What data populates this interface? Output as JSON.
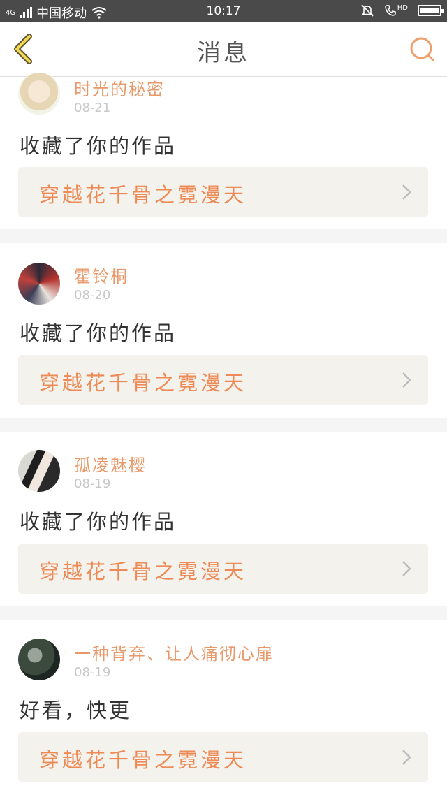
{
  "status_bar": {
    "network": "4G",
    "carrier": "中国移动",
    "time": "10:17",
    "hd_label": "HD"
  },
  "nav": {
    "title": "消息",
    "accent_color": "#f0a06c"
  },
  "messages": [
    {
      "user": "时光的秘密",
      "date": "08-21",
      "action": "收藏了你的作品",
      "work": "穿越花千骨之霓漫天"
    },
    {
      "user": "霍铃桐",
      "date": "08-20",
      "action": "收藏了你的作品",
      "work": "穿越花千骨之霓漫天"
    },
    {
      "user": "孤凌魅樱",
      "date": "08-19",
      "action": "收藏了你的作品",
      "work": "穿越花千骨之霓漫天"
    },
    {
      "user": "一种背弃、让人痛彻心扉",
      "date": "08-19",
      "action": "好看，快更",
      "work": "穿越花千骨之霓漫天"
    }
  ],
  "icons": {
    "back": "chevron-left-icon",
    "search": "search-icon",
    "work_link": "chevron-right-icon"
  }
}
